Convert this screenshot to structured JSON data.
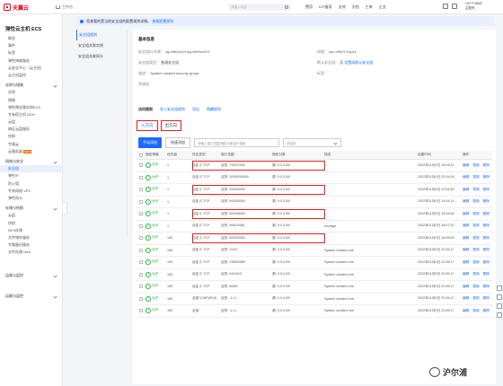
{
  "topbar": {
    "brand": "天翼云",
    "console": "工作台",
    "search_placeholder": "请输入内容",
    "nav": [
      "费用",
      "ICP备案",
      "支持",
      "文档",
      "工单",
      "企业"
    ],
    "user_id": "13*****2843",
    "user_role": "主账号"
  },
  "sidebar": {
    "title": "弹性云主机 ECS",
    "top_items": [
      "概览",
      "事件",
      "标签",
      "弹性伸缩服务",
      "安全",
      ""
    ],
    "top_items_real": [
      "概览",
      "事件",
      "标签",
      "弹性伸缩服务",
      "云安全中心（云主机）",
      "云主机监控"
    ],
    "groups": [
      {
        "label": "实例与镜像",
        "items": [
          "实例",
          "镜像",
          "弹性裸金属实例",
          "专有宿主机 DDH",
          "云盘",
          "跨区云盘服务",
          "快照",
          "专属云",
          "云服务器"
        ]
      },
      {
        "label": "网络与安全",
        "items": [
          "安全组",
          "弹性IP",
          "防火墙",
          "专有网络VPC",
          "网卡"
        ],
        "active": 0
      },
      {
        "label": "存储与快照",
        "items": [
          "云盘",
          "快照",
          "NFS",
          "文件储存服务",
          "备份与恢复",
          "天翼云备份"
        ]
      },
      {
        "label": "运维与监控",
        "items": []
      },
      {
        "label": "运维与监控",
        "items": []
      }
    ]
  },
  "sidebar_flat": {
    "title": "弹性云主机 ECS",
    "items": [
      "概览",
      "事件",
      "标签",
      "弹性伸缩服务",
      "云安全中心（云主机）",
      "云主机监控"
    ],
    "g1": "实例与镜像",
    "g1_items": [
      "实例",
      "镜像",
      "弹性裸金属实例ECS",
      "专有宿主机 DDH",
      "云盘",
      "跨区云盘服务",
      "快照",
      "专属云",
      "云服务器"
    ],
    "g2": "网络与安全",
    "g2_items": [
      "安全组",
      "弹性IP",
      "防火墙",
      "专有网络 VPC",
      "弹性网卡"
    ],
    "g3": "存储与快照",
    "g3_items": [
      "云盘",
      "快照",
      "NFS存储",
      "文件储存服务",
      "专属备份服务",
      "文件存储 NAS"
    ],
    "g4": "运维与监控",
    "g5": "运维与监控",
    "new_tag": "NEW"
  },
  "notice": {
    "text": "您查看的是当前安全组的配置规则详情。",
    "link": "查看配置规则"
  },
  "left_tabs": [
    "安全组规则",
    "安全组关联实例",
    "安全组关联网卡"
  ],
  "detail": {
    "section_title": "基本信息",
    "fields": [
      {
        "label": "安全组ID/名称：",
        "value": "sg-v9b0vx0Y/sg-v9b0vx0Y1"
      },
      {
        "label": "安全组类型：",
        "value": "普通安全组"
      },
      {
        "label": "描述：",
        "value": "System created security group"
      },
      {
        "label": "资源组：",
        "value": ""
      },
      {
        "label": "网络：",
        "value": "vpc-v9b0Y1/vpc1"
      },
      {
        "label": "默认安全组：",
        "value": "否"
      },
      {
        "label": "标签：",
        "value": ""
      }
    ],
    "side_link": "设置成默认安全组"
  },
  "rules": {
    "title": "访问规则",
    "links": [
      "导入安全组规则",
      "导出",
      "隐藏规则"
    ],
    "tabs": [
      "入方向",
      "出方向"
    ],
    "add_button": "手动添加",
    "quick_button": "快速添加",
    "filter_placeholder": "请输入端口范围/授权对象进行搜索",
    "select_placeholder": "请选择",
    "headers": [
      "",
      "授权策略",
      "优先级",
      "协议类型",
      "端口范围",
      "授权对象",
      "描述",
      "创建时间",
      "操作"
    ],
    "rows": [
      {
        "policy": "允许",
        "priority": "1",
        "proto": "自定义 TCP",
        "port": "目的: 7000/7000",
        "obj": "源: 0.0.0.0/0",
        "desc": "",
        "time": "2022年11月9日 15:04:41",
        "ops": [
          "编辑",
          "复制",
          "删除"
        ],
        "hl": true
      },
      {
        "policy": "允许",
        "priority": "1",
        "proto": "自定义 TCP",
        "port": "目的: 30000/30000",
        "obj": "源: 0.0.0.0/0",
        "desc": "",
        "time": "2022年11月9日 22:44:06",
        "ops": [
          "编辑",
          "复制",
          "删除"
        ],
        "hl": false
      },
      {
        "policy": "允许",
        "priority": "1",
        "proto": "自定义 TCP",
        "port": "目的: 6000/6000",
        "obj": "源: 0.0.0.0/0",
        "desc": "",
        "time": "2022年11月9日 22:44:45",
        "ops": [
          "编辑",
          "复制",
          "删除"
        ],
        "hl": true
      },
      {
        "policy": "允许",
        "priority": "1",
        "proto": "自定义 TCP",
        "port": "目的: 6000/6000",
        "obj": "源: 0.0.0.0/0",
        "desc": "",
        "time": "2022年11月9日 14:44:14",
        "ops": [
          "编辑",
          "复制",
          "删除"
        ],
        "hl": false
      },
      {
        "policy": "允许",
        "priority": "1",
        "proto": "自定义 TCP",
        "port": "目的: 8000/8000",
        "obj": "源: 0.0.0.0/0",
        "desc": "",
        "time": "2022年11月9日 15:38:46",
        "ops": [
          "编辑",
          "复制",
          "删除"
        ],
        "hl": true
      },
      {
        "policy": "允许",
        "priority": "1",
        "proto": "自定义 TCP",
        "port": "目的: 6081/6081",
        "obj": "源: 0.0.0.0/0",
        "desc": "nextdge",
        "time": "2022年11月9日 16:57:33",
        "ops": [
          "编辑",
          "复制",
          "删除"
        ],
        "hl": false
      },
      {
        "policy": "允许",
        "priority": "100",
        "proto": "自定义 TCP",
        "port": "目的: 5000/5000",
        "obj": "源: 0.0.0.0/0",
        "desc": "",
        "time": "2022年11月9日 16:59:55",
        "ops": [
          "编辑",
          "复制",
          "删除"
        ],
        "hl": true
      },
      {
        "policy": "允许",
        "priority": "100",
        "proto": "自定义 TCP",
        "port": "目的: 22/22",
        "obj": "源: 0.0.0.0/0",
        "desc": "System created rule",
        "time": "2022年11月5日 22:05:17",
        "ops": [
          "编辑",
          "复制",
          "删除"
        ],
        "hl": false
      },
      {
        "policy": "允许",
        "priority": "100",
        "proto": "自定义 TCP",
        "port": "目的: 3389/3389",
        "obj": "源: 0.0.0.0/0",
        "desc": "System created rule",
        "time": "2022年11月5日 22:05:17",
        "ops": [
          "编辑",
          "复制",
          "删除"
        ],
        "hl": false
      },
      {
        "policy": "允许",
        "priority": "100",
        "proto": "自定义 TCP",
        "port": "目的: 443/443",
        "obj": "源: 0.0.0.0/0",
        "desc": "System created rule",
        "time": "2022年11月5日 22:05:17",
        "ops": [
          "编辑",
          "复制",
          "删除"
        ],
        "hl": false
      },
      {
        "policy": "允许",
        "priority": "100",
        "proto": "自定义 TCP",
        "port": "目的: 80/80",
        "obj": "源: 0.0.0.0/0",
        "desc": "System created rule",
        "time": "2022年11月5日 22:05:17",
        "ops": [
          "编辑",
          "复制",
          "删除"
        ],
        "hl": false
      },
      {
        "policy": "允许",
        "priority": "100",
        "proto": "全部 ICMP(IPv4)",
        "port": "目的: -1/-1",
        "obj": "源: 0.0.0.0/0",
        "desc": "System created rule",
        "time": "2022年11月5日 22:05:17",
        "ops": [
          "编辑",
          "复制",
          "删除"
        ],
        "hl": false
      },
      {
        "policy": "允许",
        "priority": "100",
        "proto": "全部",
        "port": "目的: -1/-1",
        "obj": "源: 0.0.0.0/0",
        "desc": "System created rule",
        "time": "2022年11月5日 22:05:17",
        "ops": [
          "编辑",
          "复制",
          "删除"
        ],
        "hl": false
      }
    ]
  },
  "watermark": "沪尔浦",
  "colors": {
    "accent": "#1a6cff",
    "brand": "#e60012",
    "highlight": "#e02020",
    "allow": "#1bb934"
  }
}
